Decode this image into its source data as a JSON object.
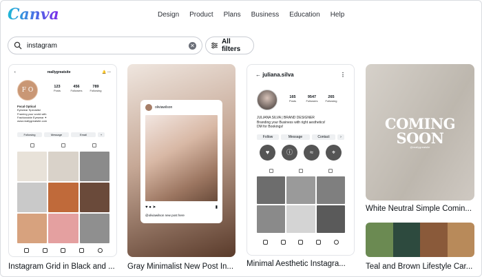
{
  "app": {
    "logo": "Canva"
  },
  "nav": [
    "Design",
    "Product",
    "Plans",
    "Business",
    "Education",
    "Help"
  ],
  "search": {
    "value": "instagram",
    "filters_label": "All filters"
  },
  "cards": [
    {
      "title": "Instagram Grid in Black and ...",
      "username": "reallygreatsite",
      "avatar_text": "F O",
      "stats": [
        {
          "value": "123",
          "label": "Posts"
        },
        {
          "value": "456",
          "label": "Followers"
        },
        {
          "value": "789",
          "label": "Following"
        }
      ],
      "bio": [
        "Focal Optical",
        "Eyewear Specialist",
        "Framing your world with",
        "Fashionable Eyewear ✦",
        "www.reallygreatsite.com"
      ],
      "buttons": [
        "Following",
        "Message",
        "Email"
      ]
    },
    {
      "title": "Gray Minimalist New Post In...",
      "username": "oliviawilson",
      "caption": "@oliviawilson new post here"
    },
    {
      "title": "Minimal Aesthetic Instagra...",
      "username": "juliana.silva",
      "stats": [
        {
          "value": "165",
          "label": "Posts"
        },
        {
          "value": "9547",
          "label": "Followers"
        },
        {
          "value": "265",
          "label": "Following"
        }
      ],
      "bio": [
        "JULIANA SILVA | BRAND DESIGNER",
        "Branding your Business with right aesthetics!",
        "DM for Bookings!"
      ],
      "buttons": [
        "Follow",
        "Message",
        "Contact"
      ]
    },
    {
      "title": "White Neutral Simple Comin...",
      "headline_1": "COMING",
      "headline_2": "SOON",
      "sub": "@reallygreatsite"
    },
    {
      "title": "Teal and Brown Lifestyle Car..."
    }
  ]
}
